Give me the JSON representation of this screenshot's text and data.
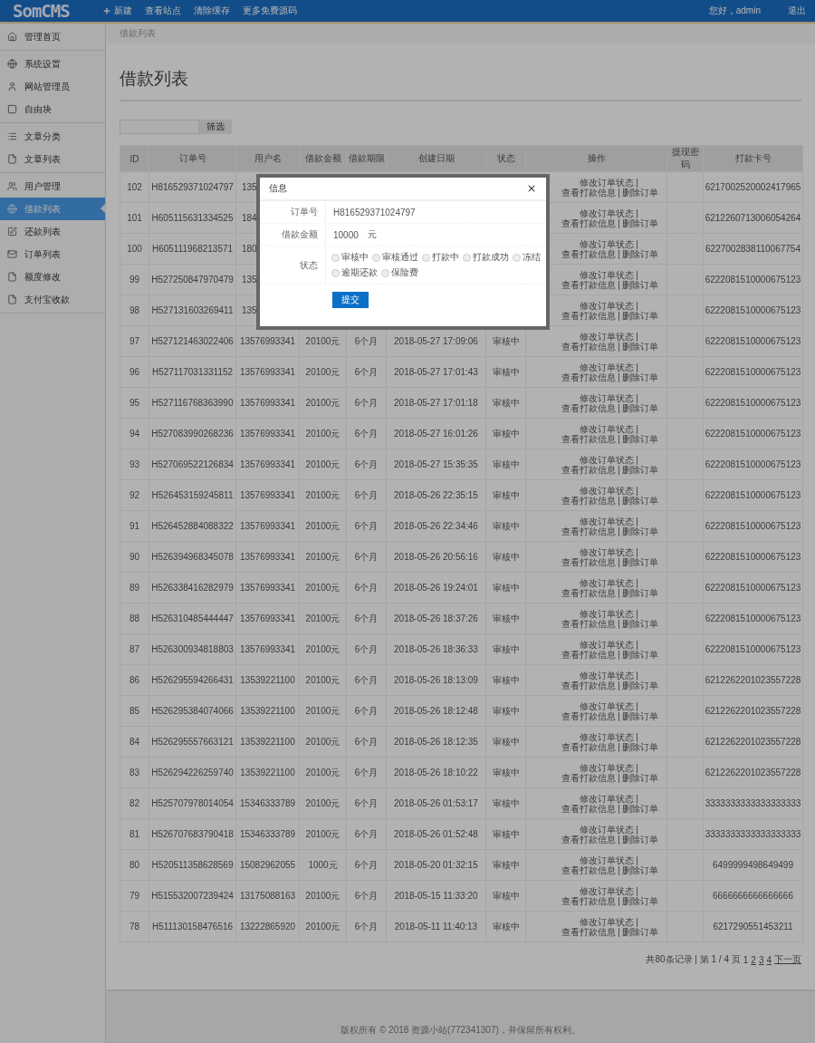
{
  "header": {
    "logo": "SomCMS",
    "actions": [
      {
        "label": "新建"
      },
      {
        "label": "查看站点"
      },
      {
        "label": "清除缓存"
      },
      {
        "label": "更多免费源码"
      }
    ],
    "greeting": "您好，admin",
    "logout": "退出"
  },
  "sidebar": {
    "groups": [
      {
        "items": [
          {
            "label": "管理首页",
            "selected": false
          }
        ]
      },
      {
        "items": [
          {
            "label": "系统设置",
            "selected": false
          },
          {
            "label": "网站管理员",
            "selected": false
          },
          {
            "label": "自由块",
            "selected": false
          }
        ]
      },
      {
        "items": [
          {
            "label": "文章分类",
            "selected": false
          },
          {
            "label": "文章列表",
            "selected": false
          }
        ]
      },
      {
        "items": [
          {
            "label": "用户管理",
            "selected": false
          },
          {
            "label": "借款列表",
            "selected": true
          },
          {
            "label": "还款列表",
            "selected": false
          },
          {
            "label": "订单列表",
            "selected": false
          },
          {
            "label": "额度修改",
            "selected": false
          },
          {
            "label": "支付宝收款",
            "selected": false
          }
        ]
      }
    ]
  },
  "breadcrumb": "借款列表",
  "title": "借款列表",
  "search": {
    "button": "筛选"
  },
  "table": {
    "columns": [
      "ID",
      "订单号",
      "用户名",
      "借款金额",
      "借款期限",
      "创建日期",
      "状态",
      "操作",
      "提现密码",
      "打款卡号"
    ],
    "separator": "|",
    "rows": [
      {
        "id": "102",
        "order": "H816529371024797",
        "user": "135",
        "actions": [
          "修改订单状态",
          "查看打款信息",
          "删除订单"
        ],
        "card": "6217002520002417965"
      },
      {
        "id": "101",
        "order": "H605115631334525",
        "user": "184",
        "actions": [
          "修改订单状态",
          "查看打款信息",
          "删除订单"
        ],
        "card": "6212260713006054264"
      },
      {
        "id": "100",
        "order": "H605111968213571",
        "user": "180",
        "actions": [
          "修改订单状态",
          "查看打款信息",
          "删除订单"
        ],
        "card": "6227002838110067754"
      },
      {
        "id": "99",
        "order": "H527250847970479",
        "user": "135",
        "actions": [
          "修改订单状态",
          "查看打款信息",
          "删除订单"
        ],
        "card": "6222081510000675123"
      },
      {
        "id": "98",
        "order": "H527131603269411",
        "user": "135",
        "actions": [
          "修改订单状态",
          "查看打款信息",
          "删除订单"
        ],
        "card": "6222081510000675123"
      },
      {
        "id": "97",
        "order": "H527121463022406",
        "user": "13576993341",
        "amount": "20100元",
        "term": "6个月",
        "date": "2018-05-27 17:09:06",
        "status": "审核中",
        "actions": [
          "修改订单状态",
          "查看打款信息",
          "删除订单"
        ],
        "card": "6222081510000675123"
      },
      {
        "id": "96",
        "order": "H527117031331152",
        "user": "13576993341",
        "amount": "20100元",
        "term": "6个月",
        "date": "2018-05-27 17:01:43",
        "status": "审核中",
        "actions": [
          "修改订单状态",
          "查看打款信息",
          "删除订单"
        ],
        "card": "6222081510000675123"
      },
      {
        "id": "95",
        "order": "H527116768363990",
        "user": "13576993341",
        "amount": "20100元",
        "term": "6个月",
        "date": "2018-05-27 17:01:18",
        "status": "审核中",
        "actions": [
          "修改订单状态",
          "查看打款信息",
          "删除订单"
        ],
        "card": "6222081510000675123"
      },
      {
        "id": "94",
        "order": "H527083990268236",
        "user": "13576993341",
        "amount": "20100元",
        "term": "6个月",
        "date": "2018-05-27 16:01:26",
        "status": "审核中",
        "actions": [
          "修改订单状态",
          "查看打款信息",
          "删除订单"
        ],
        "card": "6222081510000675123"
      },
      {
        "id": "93",
        "order": "H527069522126834",
        "user": "13576993341",
        "amount": "20100元",
        "term": "6个月",
        "date": "2018-05-27 15:35:35",
        "status": "审核中",
        "actions": [
          "修改订单状态",
          "查看打款信息",
          "删除订单"
        ],
        "card": "6222081510000675123"
      },
      {
        "id": "92",
        "order": "H526453159245811",
        "user": "13576993341",
        "amount": "20100元",
        "term": "6个月",
        "date": "2018-05-26 22:35:15",
        "status": "审核中",
        "actions": [
          "修改订单状态",
          "查看打款信息",
          "删除订单"
        ],
        "card": "6222081510000675123"
      },
      {
        "id": "91",
        "order": "H526452884088322",
        "user": "13576993341",
        "amount": "20100元",
        "term": "6个月",
        "date": "2018-05-26 22:34:46",
        "status": "审核中",
        "actions": [
          "修改订单状态",
          "查看打款信息",
          "删除订单"
        ],
        "card": "6222081510000675123"
      },
      {
        "id": "90",
        "order": "H526394968345078",
        "user": "13576993341",
        "amount": "20100元",
        "term": "6个月",
        "date": "2018-05-26 20:56:16",
        "status": "审核中",
        "actions": [
          "修改订单状态",
          "查看打款信息",
          "删除订单"
        ],
        "card": "6222081510000675123"
      },
      {
        "id": "89",
        "order": "H526338416282979",
        "user": "13576993341",
        "amount": "20100元",
        "term": "6个月",
        "date": "2018-05-26 19:24:01",
        "status": "审核中",
        "actions": [
          "修改订单状态",
          "查看打款信息",
          "删除订单"
        ],
        "card": "6222081510000675123"
      },
      {
        "id": "88",
        "order": "H526310485444447",
        "user": "13576993341",
        "amount": "20100元",
        "term": "6个月",
        "date": "2018-05-26 18:37:26",
        "status": "审核中",
        "actions": [
          "修改订单状态",
          "查看打款信息",
          "删除订单"
        ],
        "card": "6222081510000675123"
      },
      {
        "id": "87",
        "order": "H526300934818803",
        "user": "13576993341",
        "amount": "20100元",
        "term": "6个月",
        "date": "2018-05-26 18:36:33",
        "status": "审核中",
        "actions": [
          "修改订单状态",
          "查看打款信息",
          "删除订单"
        ],
        "card": "6222081510000675123"
      },
      {
        "id": "86",
        "order": "H526295594266431",
        "user": "13539221100",
        "amount": "20100元",
        "term": "6个月",
        "date": "2018-05-26 18:13:09",
        "status": "审核中",
        "actions": [
          "修改订单状态",
          "查看打款信息",
          "删除订单"
        ],
        "card": "6212262201023557228"
      },
      {
        "id": "85",
        "order": "H526295384074066",
        "user": "13539221100",
        "amount": "20100元",
        "term": "6个月",
        "date": "2018-05-26 18:12:48",
        "status": "审核中",
        "actions": [
          "修改订单状态",
          "查看打款信息",
          "删除订单"
        ],
        "card": "6212262201023557228"
      },
      {
        "id": "84",
        "order": "H526295557663121",
        "user": "13539221100",
        "amount": "20100元",
        "term": "6个月",
        "date": "2018-05-26 18:12:35",
        "status": "审核中",
        "actions": [
          "修改订单状态",
          "查看打款信息",
          "删除订单"
        ],
        "card": "6212262201023557228"
      },
      {
        "id": "83",
        "order": "H526294226259740",
        "user": "13539221100",
        "amount": "20100元",
        "term": "6个月",
        "date": "2018-05-26 18:10:22",
        "status": "审核中",
        "actions": [
          "修改订单状态",
          "查看打款信息",
          "删除订单"
        ],
        "card": "6212262201023557228"
      },
      {
        "id": "82",
        "order": "H525707978014054",
        "user": "15346333789",
        "amount": "20100元",
        "term": "6个月",
        "date": "2018-05-26 01:53:17",
        "status": "审核中",
        "actions": [
          "修改订单状态",
          "查看打款信息",
          "删除订单"
        ],
        "card": "3333333333333333333"
      },
      {
        "id": "81",
        "order": "H526707683790418",
        "user": "15346333789",
        "amount": "20100元",
        "term": "6个月",
        "date": "2018-05-26 01:52:48",
        "status": "审核中",
        "actions": [
          "修改订单状态",
          "查看打款信息",
          "删除订单"
        ],
        "card": "3333333333333333333"
      },
      {
        "id": "80",
        "order": "H520511358628569",
        "user": "15082962055",
        "amount": "1000元",
        "term": "6个月",
        "date": "2018-05-20 01:32:15",
        "status": "审核中",
        "actions": [
          "修改订单状态",
          "查看打款信息",
          "删除订单"
        ],
        "card": "6499999498649499"
      },
      {
        "id": "79",
        "order": "H515532007239424",
        "user": "13175088163",
        "amount": "20100元",
        "term": "6个月",
        "date": "2018-05-15 11:33:20",
        "status": "审核中",
        "actions": [
          "修改订单状态",
          "查看打款信息",
          "删除订单"
        ],
        "card": "6666666666666666"
      },
      {
        "id": "78",
        "order": "H511130158476516",
        "user": "13222865920",
        "amount": "20100元",
        "term": "6个月",
        "date": "2018-05-11 11:40:13",
        "status": "审核中",
        "actions": [
          "修改订单状态",
          "查看打款信息",
          "删除订单"
        ],
        "card": "6217290551453211"
      }
    ]
  },
  "pagination": {
    "summary": "共80条记录 | 第 1 / 4 页",
    "pages": [
      {
        "label": "1",
        "selected": true
      },
      {
        "label": "2",
        "selected": false
      },
      {
        "label": "3",
        "selected": false
      },
      {
        "label": "4",
        "selected": false
      }
    ],
    "next": "下一页"
  },
  "footer": "版权所有 © 2018 资源小站(772341307)，并保留所有权利。",
  "modal": {
    "title": "信息",
    "fields": [
      {
        "label": "订单号",
        "value": "H816529371024797"
      },
      {
        "label": "借款金额",
        "value": "10000",
        "suffix": "元"
      }
    ],
    "status": {
      "label": "状态",
      "options": [
        {
          "label": "审核中",
          "selected": false
        },
        {
          "label": "审核通过",
          "selected": false
        },
        {
          "label": "打款中",
          "selected": false
        },
        {
          "label": "打款成功",
          "selected": false
        },
        {
          "label": "冻结",
          "selected": false
        },
        {
          "label": "逾期还款",
          "selected": false
        },
        {
          "label": "保险费",
          "selected": false
        }
      ]
    },
    "submit": "提交"
  }
}
